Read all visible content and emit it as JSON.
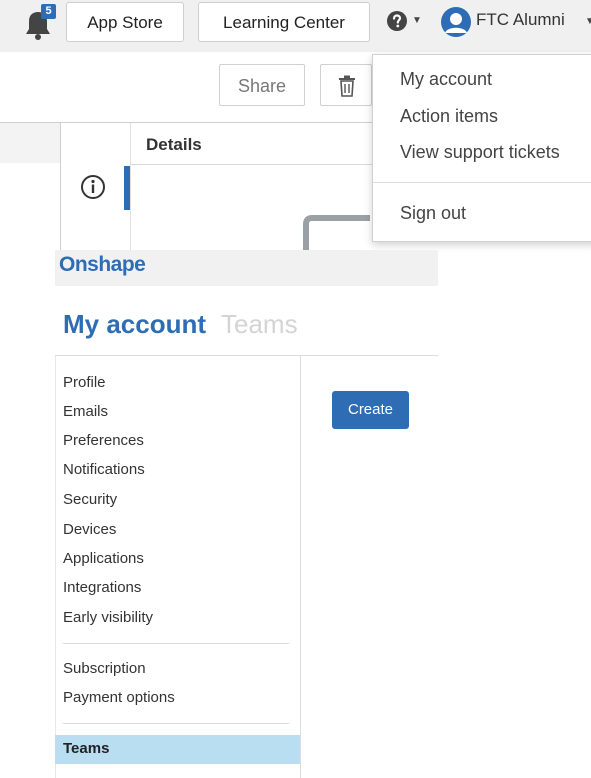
{
  "topbar": {
    "notification_count": "5",
    "app_store_label": "App Store",
    "learning_center_label": "Learning Center",
    "user_name": "FTC Alumni"
  },
  "toolbar": {
    "share_label": "Share"
  },
  "panel": {
    "details_label": "Details"
  },
  "user_menu": {
    "items": [
      "My account",
      "Action items",
      "View support tickets"
    ],
    "sign_out": "Sign out"
  },
  "brand": "Onshape",
  "page": {
    "title_active": "My account",
    "title_inactive": "Teams"
  },
  "nav": {
    "group1": [
      "Profile",
      "Emails",
      "Preferences",
      "Notifications",
      "Security",
      "Devices",
      "Applications",
      "Integrations",
      "Early visibility"
    ],
    "group2": [
      "Subscription",
      "Payment options"
    ],
    "selected": "Teams"
  },
  "content": {
    "create_label": "Create"
  },
  "colors": {
    "accent": "#2e6db4",
    "selected_bg": "#b9def2"
  }
}
